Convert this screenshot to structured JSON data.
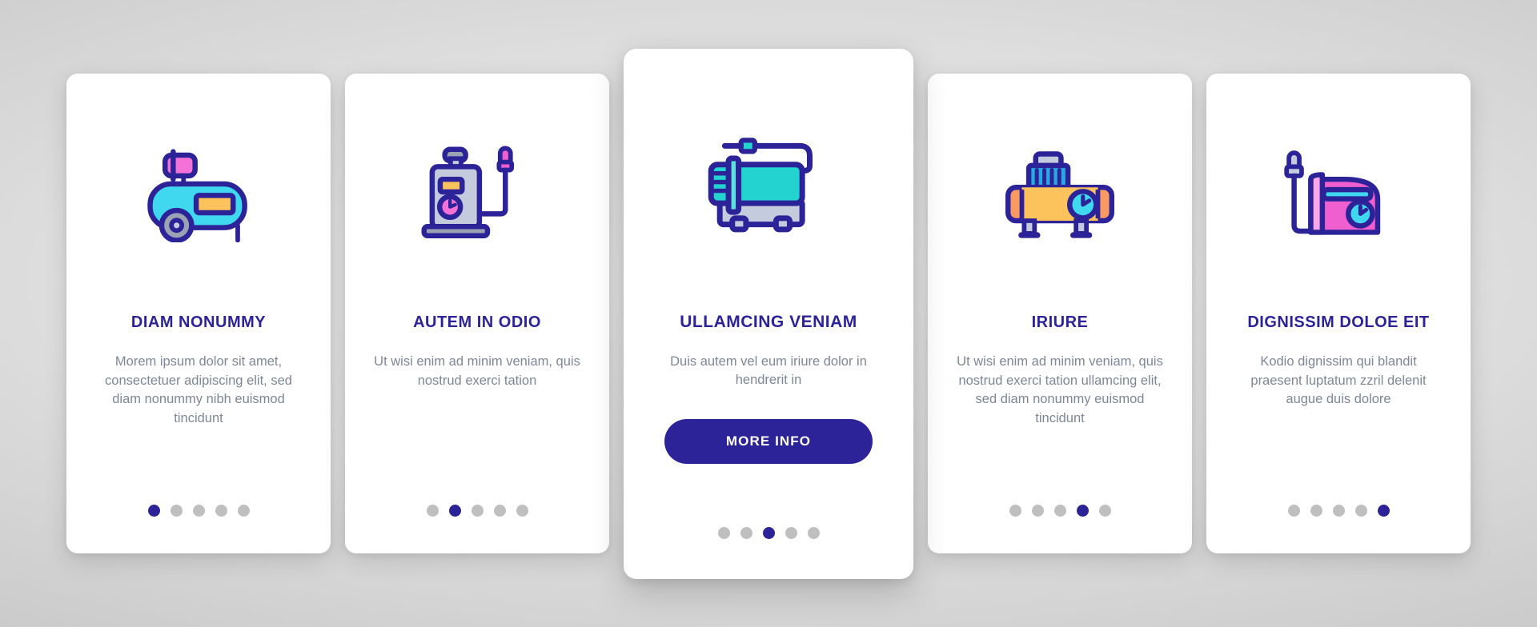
{
  "theme": {
    "accent": "#2d2398",
    "title_color": "#2d2398",
    "body_text_color": "#7f8795",
    "card_bg": "#ffffff",
    "dot_inactive": "#bfbfbf",
    "dot_active": "#2d2398",
    "page_bg": "#d8d8d8",
    "icon_cyan": "#3fd8ef",
    "icon_teal": "#23d3cf",
    "icon_pink": "#f472d8",
    "icon_magenta": "#ef5fd0",
    "icon_yellow": "#fcc25c",
    "icon_orange": "#f89a62",
    "icon_gray": "#c3cbdd",
    "icon_blue": "#27a9e1",
    "icon_outline": "#2d2398"
  },
  "cards": [
    {
      "id": "card-1",
      "icon_name": "air-compressor-tank-icon",
      "title": "DIAM NONUMMY",
      "description": "Morem ipsum dolor sit amet, consectetuer adipiscing elit, sed diam nonummy nibh euismod tincidunt",
      "dots": {
        "count": 5,
        "active_index": 0
      },
      "featured": false,
      "button": null
    },
    {
      "id": "card-2",
      "icon_name": "pressure-sprayer-icon",
      "title": "AUTEM IN ODIO",
      "description": "Ut wisi enim ad minim veniam, quis nostrud exerci tation",
      "dots": {
        "count": 5,
        "active_index": 1
      },
      "featured": false,
      "button": null
    },
    {
      "id": "card-3",
      "icon_name": "compressor-motor-hose-icon",
      "title": "ULLAMCING VENIAM",
      "description": "Duis autem vel eum iriure dolor in hendrerit in",
      "dots": {
        "count": 5,
        "active_index": 2
      },
      "featured": true,
      "button": {
        "label": "MORE INFO",
        "name": "more-info-button"
      }
    },
    {
      "id": "card-4",
      "icon_name": "horizontal-compressor-gauge-icon",
      "title": "IRIURE",
      "description": "Ut wisi enim ad minim veniam, quis nostrud exerci tation ullamcing elit, sed diam nonummy euismod tincidunt",
      "dots": {
        "count": 5,
        "active_index": 3
      },
      "featured": false,
      "button": null
    },
    {
      "id": "card-5",
      "icon_name": "portable-compressor-case-icon",
      "title": "DIGNISSIM DOLOE EIT",
      "description": "Kodio dignissim qui blandit praesent luptatum zzril delenit augue duis dolore",
      "dots": {
        "count": 5,
        "active_index": 4
      },
      "featured": false,
      "button": null
    }
  ]
}
